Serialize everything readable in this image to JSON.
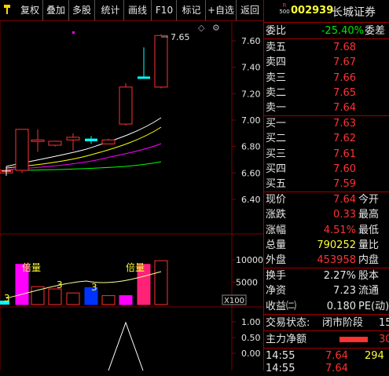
{
  "toolbar": {
    "items": [
      "复权",
      "叠加",
      "多股",
      "统计",
      "画线",
      "F10",
      "标记",
      "+自选",
      "返回"
    ]
  },
  "chart": {
    "price_axis": [
      "7.60",
      "7.40",
      "7.20",
      "7.00",
      "6.80",
      "6.60",
      "6.40"
    ],
    "volume_axis": [
      "10000",
      "5000"
    ],
    "volume_unit": "X100",
    "indicator_axis": [
      "1.00",
      "0.50",
      "0.00"
    ],
    "high_label": "7.65",
    "volume_labels": [
      "倍量",
      "3",
      "3",
      "3",
      "倍量"
    ],
    "colors": {
      "up": "#ff3232",
      "down": "#00ffff",
      "grid": "#800000",
      "ma5": "#ffffff",
      "ma10": "#ffff00",
      "ma20": "#ff00ff",
      "ma60": "#00ff00",
      "vol_magenta": "#ff00ff",
      "vol_pink": "#ff2277",
      "vol_blue": "#0033ff"
    },
    "candles": [
      {
        "o": 6.6,
        "h": 6.62,
        "l": 6.58,
        "c": 6.62
      },
      {
        "o": 6.62,
        "h": 6.88,
        "l": 6.6,
        "c": 6.93
      },
      {
        "o": 6.84,
        "h": 6.93,
        "l": 6.76,
        "c": 6.85
      },
      {
        "o": 6.81,
        "h": 6.84,
        "l": 6.8,
        "c": 6.84
      },
      {
        "o": 6.85,
        "h": 6.9,
        "l": 6.77,
        "c": 6.87
      },
      {
        "o": 6.84,
        "h": 6.88,
        "l": 6.82,
        "c": 6.86
      },
      {
        "o": 6.85,
        "h": 6.86,
        "l": 6.82,
        "c": 6.82
      },
      {
        "o": 6.97,
        "h": 7.28,
        "l": 6.96,
        "c": 7.25
      },
      {
        "o": 7.33,
        "h": 7.55,
        "l": 7.33,
        "c": 7.33
      },
      {
        "o": 7.25,
        "h": 7.65,
        "l": 7.24,
        "c": 7.64
      }
    ],
    "volumes": [
      0,
      9000,
      4000,
      3500,
      2600,
      3800,
      2000,
      2000,
      9000,
      9800
    ],
    "indicator_values": [
      null,
      null,
      null,
      null,
      null,
      null,
      0,
      1.0,
      0
    ]
  },
  "quote": {
    "header": {
      "badge_top": "R",
      "badge_bottom": "500",
      "code": "002939",
      "name": "长城证券"
    },
    "weibi": {
      "label": "委比",
      "value": "-25.40%",
      "right": "委差"
    },
    "sell": [
      {
        "label": "卖五",
        "price": "7.68"
      },
      {
        "label": "卖四",
        "price": "7.67"
      },
      {
        "label": "卖三",
        "price": "7.66"
      },
      {
        "label": "卖二",
        "price": "7.65"
      },
      {
        "label": "卖一",
        "price": "7.64"
      }
    ],
    "buy": [
      {
        "label": "买一",
        "price": "7.63"
      },
      {
        "label": "买二",
        "price": "7.62"
      },
      {
        "label": "买三",
        "price": "7.61"
      },
      {
        "label": "买四",
        "price": "7.60"
      },
      {
        "label": "买五",
        "price": "7.59"
      }
    ],
    "stats1": [
      {
        "label": "现价",
        "value": "7.64",
        "right": "今开"
      },
      {
        "label": "涨跌",
        "value": "0.33",
        "right": "最高"
      },
      {
        "label": "涨幅",
        "value": "4.51%",
        "right": "最低"
      },
      {
        "label": "总量",
        "value": "790252",
        "right": "量比"
      },
      {
        "label": "外盘",
        "value": "453958",
        "right": "内盘"
      }
    ],
    "stats2": [
      {
        "label": "换手",
        "value": "2.27%",
        "right": "股本"
      },
      {
        "label": "净资",
        "value": "7.23",
        "right": "流通"
      },
      {
        "label": "收益㈡",
        "value": "0.180",
        "right": "PE(动)"
      }
    ],
    "trade_status": {
      "label": "交易状态:",
      "value": "闭市阶段",
      "extra": "15"
    },
    "main_flow": {
      "label": "主力净额",
      "value": "30"
    },
    "ticks": [
      {
        "time": "14:55",
        "price": "7.64",
        "vol": "294"
      },
      {
        "time": "14:55",
        "price": "7.64",
        "vol": ""
      }
    ]
  }
}
